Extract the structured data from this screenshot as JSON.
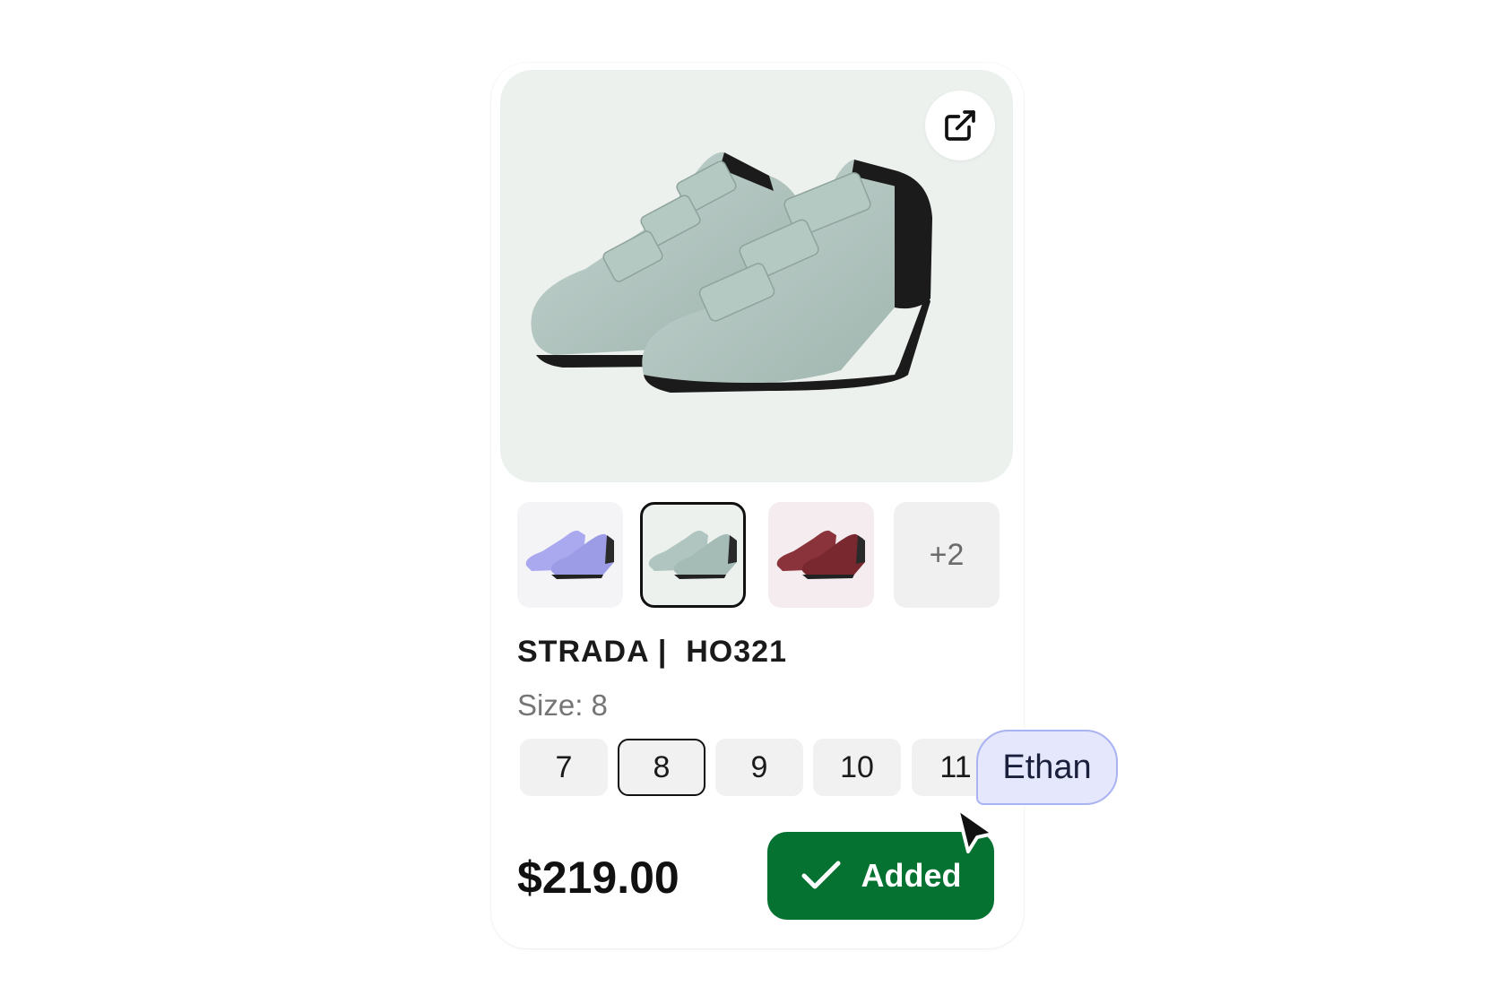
{
  "product": {
    "title": "STRADA |  HO321",
    "size_label": "Size: 8",
    "price": "$219.00",
    "selected_size": "8",
    "sizes": [
      "7",
      "8",
      "9",
      "10",
      "11"
    ]
  },
  "gallery": {
    "thumbnails": [
      {
        "color_name": "iridescent-lavender",
        "color": "#9f9fe6",
        "bg": "#f4f4f6",
        "selected": false
      },
      {
        "color_name": "sage",
        "color": "#a5bcb6",
        "bg": "#edf1ee",
        "selected": true
      },
      {
        "color_name": "burgundy",
        "color": "#7a2830",
        "bg": "#f4ecee",
        "selected": false
      }
    ],
    "more_label": "+2"
  },
  "actions": {
    "added_label": "Added",
    "external_link_icon": "external-link-icon"
  },
  "collaborator": {
    "name": "Ethan",
    "tag_color": "#e5e8fc",
    "border_color": "#a9b2f2"
  },
  "colors": {
    "accent_green": "#057231",
    "hero_bg": "#edf1ee"
  }
}
